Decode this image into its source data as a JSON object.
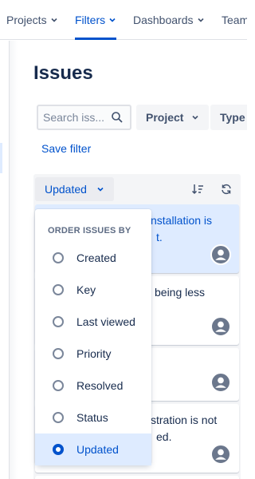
{
  "nav": {
    "items": [
      {
        "label": "Projects"
      },
      {
        "label": "Filters"
      },
      {
        "label": "Dashboards"
      },
      {
        "label": "Teams"
      }
    ]
  },
  "page": {
    "title": "Issues"
  },
  "filters": {
    "search_placeholder": "Search iss...",
    "project_label": "Project",
    "type_label": "Type",
    "save_filter_label": "Save filter"
  },
  "list": {
    "sort_label": "Updated",
    "cards": [
      {
        "line1": "nstallation is",
        "line2": "t."
      },
      {
        "line1": "being less",
        "line2": ""
      },
      {
        "line1": "",
        "line2": ""
      },
      {
        "line1": "stration is not",
        "line2": "ed."
      }
    ]
  },
  "sort_menu": {
    "heading": "ORDER ISSUES BY",
    "options": [
      "Created",
      "Key",
      "Last viewed",
      "Priority",
      "Resolved",
      "Status",
      "Updated"
    ],
    "selected": "Updated"
  },
  "colors": {
    "accent": "#0052cc",
    "selected_bg": "#deebff",
    "panel_bg": "#f4f5f7"
  },
  "icons": {
    "search": "search-icon",
    "sort_order": "sort-order-icon",
    "refresh": "refresh-icon",
    "avatar": "default-avatar-icon"
  }
}
